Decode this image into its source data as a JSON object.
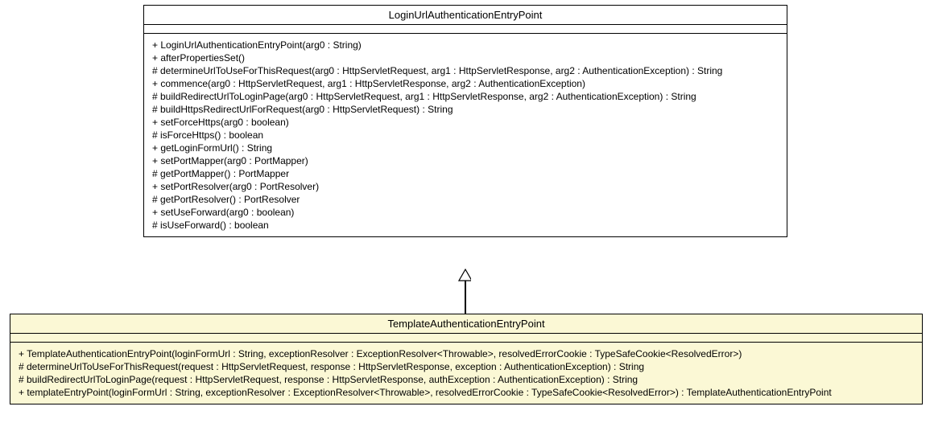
{
  "chart_data": {
    "type": "uml_class_diagram",
    "relationships": [
      {
        "type": "generalization",
        "parent": "LoginUrlAuthenticationEntryPoint",
        "child": "TemplateAuthenticationEntryPoint"
      }
    ]
  },
  "parent": {
    "title": "LoginUrlAuthenticationEntryPoint",
    "methods": [
      "+ LoginUrlAuthenticationEntryPoint(arg0 : String)",
      "+ afterPropertiesSet()",
      "# determineUrlToUseForThisRequest(arg0 : HttpServletRequest, arg1 : HttpServletResponse, arg2 : AuthenticationException) : String",
      "+ commence(arg0 : HttpServletRequest, arg1 : HttpServletResponse, arg2 : AuthenticationException)",
      "# buildRedirectUrlToLoginPage(arg0 : HttpServletRequest, arg1 : HttpServletResponse, arg2 : AuthenticationException) : String",
      "# buildHttpsRedirectUrlForRequest(arg0 : HttpServletRequest) : String",
      "+ setForceHttps(arg0 : boolean)",
      "# isForceHttps() : boolean",
      "+ getLoginFormUrl() : String",
      "+ setPortMapper(arg0 : PortMapper)",
      "# getPortMapper() : PortMapper",
      "+ setPortResolver(arg0 : PortResolver)",
      "# getPortResolver() : PortResolver",
      "+ setUseForward(arg0 : boolean)",
      "# isUseForward() : boolean"
    ]
  },
  "child": {
    "title": "TemplateAuthenticationEntryPoint",
    "methods": [
      "+ TemplateAuthenticationEntryPoint(loginFormUrl : String, exceptionResolver : ExceptionResolver<Throwable>, resolvedErrorCookie : TypeSafeCookie<ResolvedError>)",
      "# determineUrlToUseForThisRequest(request : HttpServletRequest, response : HttpServletResponse, exception : AuthenticationException) : String",
      "# buildRedirectUrlToLoginPage(request : HttpServletRequest, response : HttpServletResponse, authException : AuthenticationException) : String",
      "+ templateEntryPoint(loginFormUrl : String, exceptionResolver : ExceptionResolver<Throwable>, resolvedErrorCookie : TypeSafeCookie<ResolvedError>) : TemplateAuthenticationEntryPoint"
    ]
  }
}
